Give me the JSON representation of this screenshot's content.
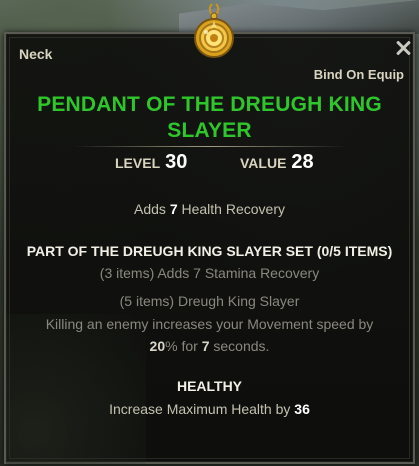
{
  "tooltip": {
    "slot": "Neck",
    "bind_type": "Bind On Equip",
    "item_name_line1": "PENDANT OF THE DREUGH KING",
    "item_name_line2": "SLAYER",
    "level_label": "LEVEL",
    "level_value": "30",
    "value_label": "VALUE",
    "value_value": "28",
    "enchant_prefix": "Adds",
    "enchant_amount": "7",
    "enchant_suffix": "Health Recovery",
    "set_header": "PART OF THE DREUGH KING SLAYER SET (0/5 ITEMS)",
    "set_bonus_3": "(3 items) Adds 7 Stamina Recovery",
    "set_bonus_5_title": "(5 items) Dreugh King Slayer",
    "set_bonus_5_line1": "Killing an enemy increases your Movement speed by",
    "set_bonus_5_percent": "20",
    "set_bonus_5_mid": "% for",
    "set_bonus_5_seconds": "7",
    "set_bonus_5_end": "seconds.",
    "trait_name": "HEALTHY",
    "trait_desc_prefix": "Increase Maximum Health by",
    "trait_desc_amount": "36"
  },
  "icons": {
    "item_icon": "gold-pendant-icon",
    "close": "close-icon"
  },
  "colors": {
    "item_name": "#2ec62a",
    "panel_bg": "#10110e",
    "label_text": "#d8d4c0",
    "dim_text": "#8a887e"
  }
}
